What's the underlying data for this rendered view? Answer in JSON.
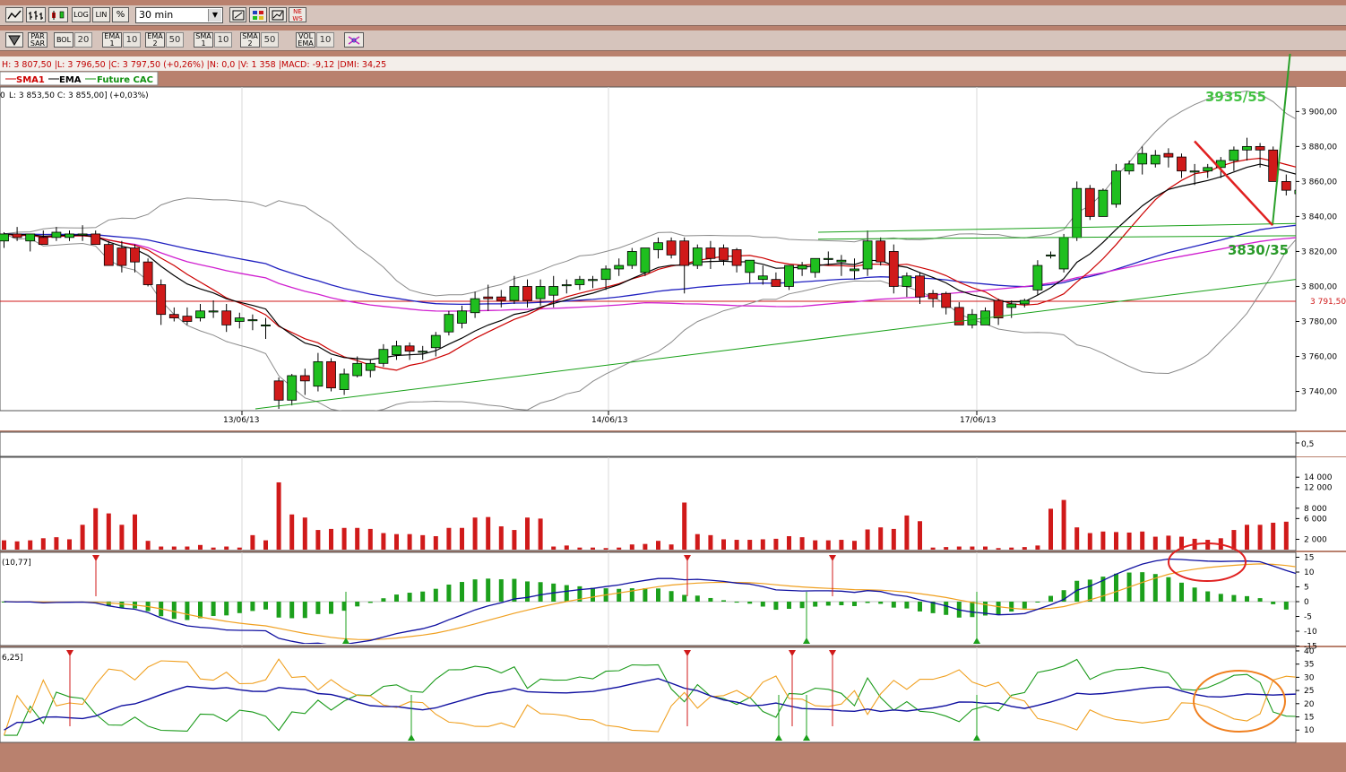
{
  "toolbar_top": {
    "icons": [
      "line-chart-icon",
      "bar-chart-icon",
      "candle-chart-icon"
    ],
    "scale_buttons": [
      "LOG",
      "LIN",
      "%"
    ],
    "timeframe": "30 min",
    "tools": [
      "ruler-icon",
      "grid-icon",
      "draw-icon",
      "news-icon"
    ],
    "news_label": "NE WS"
  },
  "toolbar_indicators": {
    "items": [
      {
        "label": "PAR SAR",
        "value": ""
      },
      {
        "label": "BOL",
        "value": "20"
      },
      {
        "label": "EMA 1",
        "value": "10"
      },
      {
        "label": "EMA 2",
        "value": "50"
      },
      {
        "label": "SMA 1",
        "value": "10"
      },
      {
        "label": "SMA 2",
        "value": "50"
      },
      {
        "label": "VOL EMA",
        "value": "10"
      }
    ]
  },
  "info_line": "H: 3 807,50 |L: 3 796,50 |C: 3 797,50 (+0,26%) |N: 0,0 |V: 1 358 |MACD: -9,12 |DMI: 34,25",
  "legend": {
    "sma1": "SMA1",
    "ema": "EMA",
    "future": "Future CAC"
  },
  "subinfo": "L: 3 853,50  C: 3 855,00] (+0,03%)",
  "subinfo_prefix": "0",
  "annotation_top": "3935/55",
  "annotation_mid": "3830/35",
  "price_marker": "3 791,50",
  "macd_label": "(10,77]",
  "dmi_label": "6,25]",
  "small_panel_tick": "0,5",
  "colors": {
    "up": "#1fbf1f",
    "down": "#d01a1a",
    "sma1": "#cc0000",
    "ema": "#000000",
    "future": "#109010",
    "bollinger": "#8a8a8a",
    "ema50": "#2020c0",
    "sma50": "#d020d0",
    "trend": "#18a018",
    "macd_line": "#1010a0",
    "macd_signal": "#f0a020"
  },
  "chart_data": {
    "type": "candlestick",
    "interval": "30 min",
    "x_labels": [
      "13/06/13",
      "14/06/13",
      "17/06/13"
    ],
    "y_ticks": [
      "3 900,00",
      "3 880,00",
      "3 860,00",
      "3 840,00",
      "3 820,00",
      "3 800,00",
      "3 780,00",
      "3 760,00",
      "3 740,00"
    ],
    "ylim": [
      3729,
      3913
    ],
    "candles": [
      [
        3826,
        3831,
        3822,
        3830
      ],
      [
        3830,
        3834,
        3826,
        3828
      ],
      [
        3826,
        3830,
        3820,
        3830
      ],
      [
        3828,
        3832,
        3824,
        3824
      ],
      [
        3828,
        3834,
        3826,
        3831
      ],
      [
        3828,
        3832,
        3826,
        3830
      ],
      [
        3830,
        3835,
        3826,
        3830
      ],
      [
        3830,
        3832,
        3824,
        3824
      ],
      [
        3824,
        3826,
        3812,
        3812
      ],
      [
        3822,
        3826,
        3808,
        3812
      ],
      [
        3822,
        3824,
        3808,
        3814
      ],
      [
        3814,
        3816,
        3800,
        3801
      ],
      [
        3801,
        3804,
        3778,
        3784
      ],
      [
        3784,
        3788,
        3780,
        3782
      ],
      [
        3783,
        3788,
        3778,
        3780
      ],
      [
        3782,
        3790,
        3780,
        3786
      ],
      [
        3786,
        3792,
        3782,
        3786
      ],
      [
        3786,
        3790,
        3774,
        3778
      ],
      [
        3780,
        3785,
        3776,
        3782
      ],
      [
        3781,
        3784,
        3775,
        3781
      ],
      [
        3778,
        3782,
        3770,
        3778
      ],
      [
        3746,
        3748,
        3730,
        3735
      ],
      [
        3735,
        3750,
        3732,
        3749
      ],
      [
        3749,
        3753,
        3738,
        3746
      ],
      [
        3743,
        3762,
        3740,
        3757
      ],
      [
        3757,
        3759,
        3740,
        3742
      ],
      [
        3741,
        3753,
        3738,
        3750
      ],
      [
        3749,
        3760,
        3748,
        3756
      ],
      [
        3752,
        3758,
        3748,
        3756
      ],
      [
        3756,
        3767,
        3754,
        3764
      ],
      [
        3761,
        3769,
        3758,
        3766
      ],
      [
        3766,
        3768,
        3758,
        3763
      ],
      [
        3763,
        3766,
        3758,
        3763
      ],
      [
        3765,
        3774,
        3760,
        3772
      ],
      [
        3774,
        3786,
        3772,
        3784
      ],
      [
        3779,
        3789,
        3776,
        3786
      ],
      [
        3785,
        3797,
        3782,
        3793
      ],
      [
        3794,
        3801,
        3786,
        3793
      ],
      [
        3794,
        3798,
        3788,
        3792
      ],
      [
        3792,
        3806,
        3790,
        3800
      ],
      [
        3800,
        3804,
        3788,
        3792
      ],
      [
        3793,
        3804,
        3789,
        3800
      ],
      [
        3795,
        3806,
        3788,
        3800
      ],
      [
        3801,
        3804,
        3796,
        3801
      ],
      [
        3801,
        3806,
        3798,
        3804
      ],
      [
        3804,
        3806,
        3799,
        3804
      ],
      [
        3804,
        3812,
        3798,
        3810
      ],
      [
        3810,
        3816,
        3806,
        3812
      ],
      [
        3812,
        3822,
        3810,
        3820
      ],
      [
        3808,
        3820,
        3806,
        3822
      ],
      [
        3821,
        3828,
        3816,
        3825
      ],
      [
        3826,
        3828,
        3816,
        3818
      ],
      [
        3826,
        3828,
        3796,
        3812
      ],
      [
        3812,
        3824,
        3810,
        3822
      ],
      [
        3822,
        3826,
        3810,
        3816
      ],
      [
        3822,
        3824,
        3812,
        3815
      ],
      [
        3821,
        3822,
        3808,
        3812
      ],
      [
        3808,
        3813,
        3802,
        3815
      ],
      [
        3804,
        3812,
        3801,
        3806
      ],
      [
        3804,
        3808,
        3800,
        3800
      ],
      [
        3800,
        3812,
        3798,
        3812
      ],
      [
        3810,
        3814,
        3806,
        3812
      ],
      [
        3808,
        3816,
        3805,
        3816
      ],
      [
        3816,
        3820,
        3812,
        3816
      ],
      [
        3814,
        3818,
        3806,
        3815
      ],
      [
        3809,
        3816,
        3804,
        3810
      ],
      [
        3810,
        3832,
        3806,
        3826
      ],
      [
        3826,
        3828,
        3812,
        3814
      ],
      [
        3820,
        3824,
        3796,
        3800
      ],
      [
        3800,
        3808,
        3794,
        3806
      ],
      [
        3806,
        3808,
        3790,
        3794
      ],
      [
        3796,
        3798,
        3788,
        3793
      ],
      [
        3796,
        3797,
        3784,
        3788
      ],
      [
        3788,
        3791,
        3780,
        3778
      ],
      [
        3778,
        3787,
        3776,
        3784
      ],
      [
        3778,
        3788,
        3778,
        3786
      ],
      [
        3792,
        3793,
        3778,
        3782
      ],
      [
        3788,
        3792,
        3782,
        3790
      ],
      [
        3790,
        3793,
        3788,
        3792
      ],
      [
        3798,
        3815,
        3795,
        3812
      ],
      [
        3818,
        3820,
        3816,
        3818
      ],
      [
        3810,
        3830,
        3808,
        3828
      ],
      [
        3828,
        3860,
        3826,
        3856
      ],
      [
        3856,
        3858,
        3838,
        3840
      ],
      [
        3840,
        3856,
        3840,
        3855
      ],
      [
        3847,
        3870,
        3845,
        3866
      ],
      [
        3866,
        3872,
        3864,
        3870
      ],
      [
        3870,
        3880,
        3864,
        3876
      ],
      [
        3870,
        3878,
        3868,
        3875
      ],
      [
        3876,
        3879,
        3868,
        3874
      ],
      [
        3874,
        3876,
        3862,
        3866
      ],
      [
        3866,
        3870,
        3858,
        3866
      ],
      [
        3866,
        3870,
        3862,
        3868
      ],
      [
        3868,
        3874,
        3862,
        3872
      ],
      [
        3872,
        3880,
        3866,
        3878
      ],
      [
        3878,
        3885,
        3872,
        3880
      ],
      [
        3880,
        3882,
        3868,
        3878
      ],
      [
        3878,
        3880,
        3862,
        3860
      ],
      [
        3860,
        3864,
        3852,
        3855
      ],
      [
        3853,
        3858,
        3852,
        3855
      ],
      [
        3855,
        3857,
        3853,
        3856
      ]
    ],
    "volume_ticks": [
      "14 000",
      "12 000",
      "8 000",
      "6 000",
      "2 000"
    ],
    "volume": [
      1800,
      1600,
      1800,
      2200,
      2400,
      2000,
      4800,
      8000,
      7000,
      4800,
      6800,
      1700,
      600,
      600,
      600,
      900,
      400,
      600,
      400,
      2800,
      1800,
      13000,
      6800,
      6200,
      3800,
      4000,
      4200,
      4200,
      4000,
      3200,
      3000,
      3000,
      2800,
      2600,
      4200,
      4200,
      6200,
      6300,
      4500,
      3800,
      6200,
      6000,
      600,
      800,
      400,
      400,
      300,
      400,
      1000,
      1100,
      1700,
      1000,
      9100,
      3000,
      2800,
      2000,
      1900,
      1900,
      2000,
      2100,
      2600,
      2400,
      1800,
      1800,
      1900,
      1700,
      3900,
      4300,
      4000,
      6600,
      5500,
      400,
      500,
      600,
      600,
      600,
      300,
      400,
      500,
      800,
      7900,
      9600,
      4300,
      3200,
      3500,
      3400,
      3300,
      3500,
      2500,
      2700,
      2500,
      2100,
      1900,
      2200,
      3800,
      4800,
      4800,
      5200,
      5400,
      5800,
      1000
    ],
    "macd_ticks": [
      "15",
      "10",
      "5",
      "0",
      "-5",
      "-10",
      "-15"
    ],
    "dmi_ticks": [
      "40",
      "35",
      "30",
      "25",
      "20",
      "15",
      "10"
    ]
  }
}
